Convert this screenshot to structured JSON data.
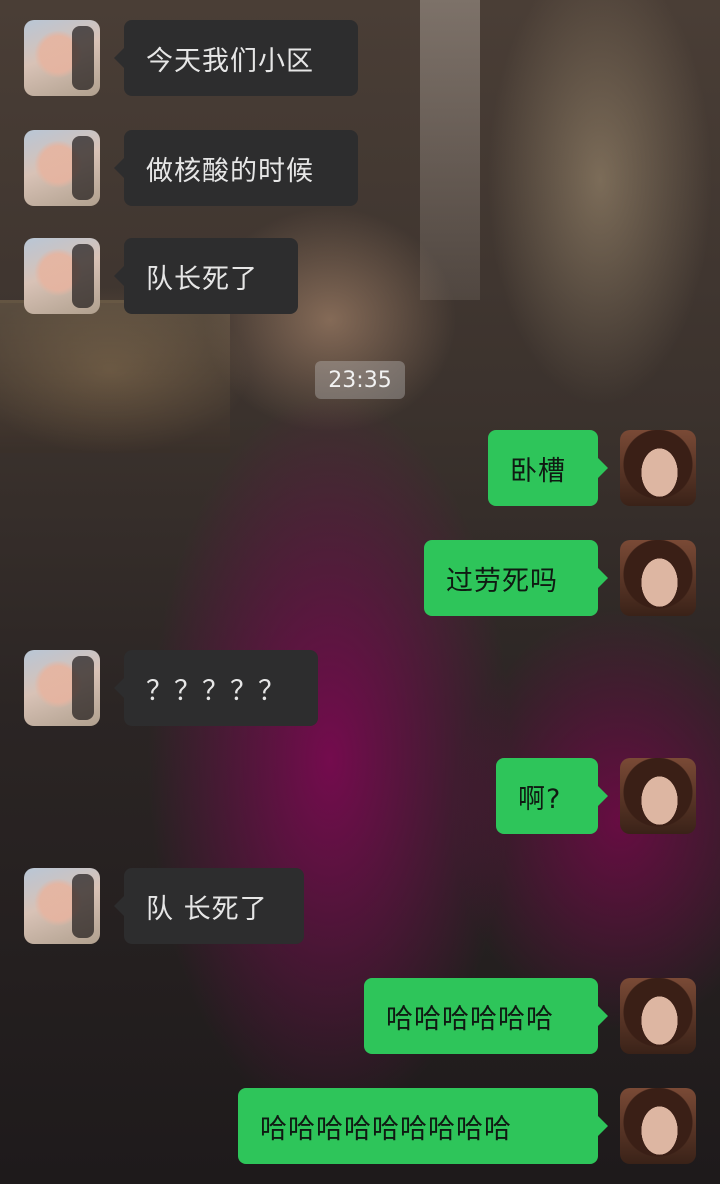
{
  "chat": {
    "timestamp": "23:35",
    "messages": [
      {
        "side": "left",
        "text": "今天我们小区"
      },
      {
        "side": "left",
        "text": "做核酸的时候"
      },
      {
        "side": "left",
        "text": "队长死了"
      },
      {
        "side": "right",
        "text": "卧槽"
      },
      {
        "side": "right",
        "text": "过劳死吗"
      },
      {
        "side": "left",
        "text": "？？？？？"
      },
      {
        "side": "right",
        "text": "啊?"
      },
      {
        "side": "left",
        "text": "队 长死了"
      },
      {
        "side": "right",
        "text": "哈哈哈哈哈哈"
      },
      {
        "side": "right",
        "text": "哈哈哈哈哈哈哈哈哈"
      }
    ]
  },
  "colors": {
    "incoming_bubble": "#2d2d2e",
    "outgoing_bubble": "#2ec55a",
    "timestamp_bg": "rgba(200,200,200,0.35)"
  }
}
